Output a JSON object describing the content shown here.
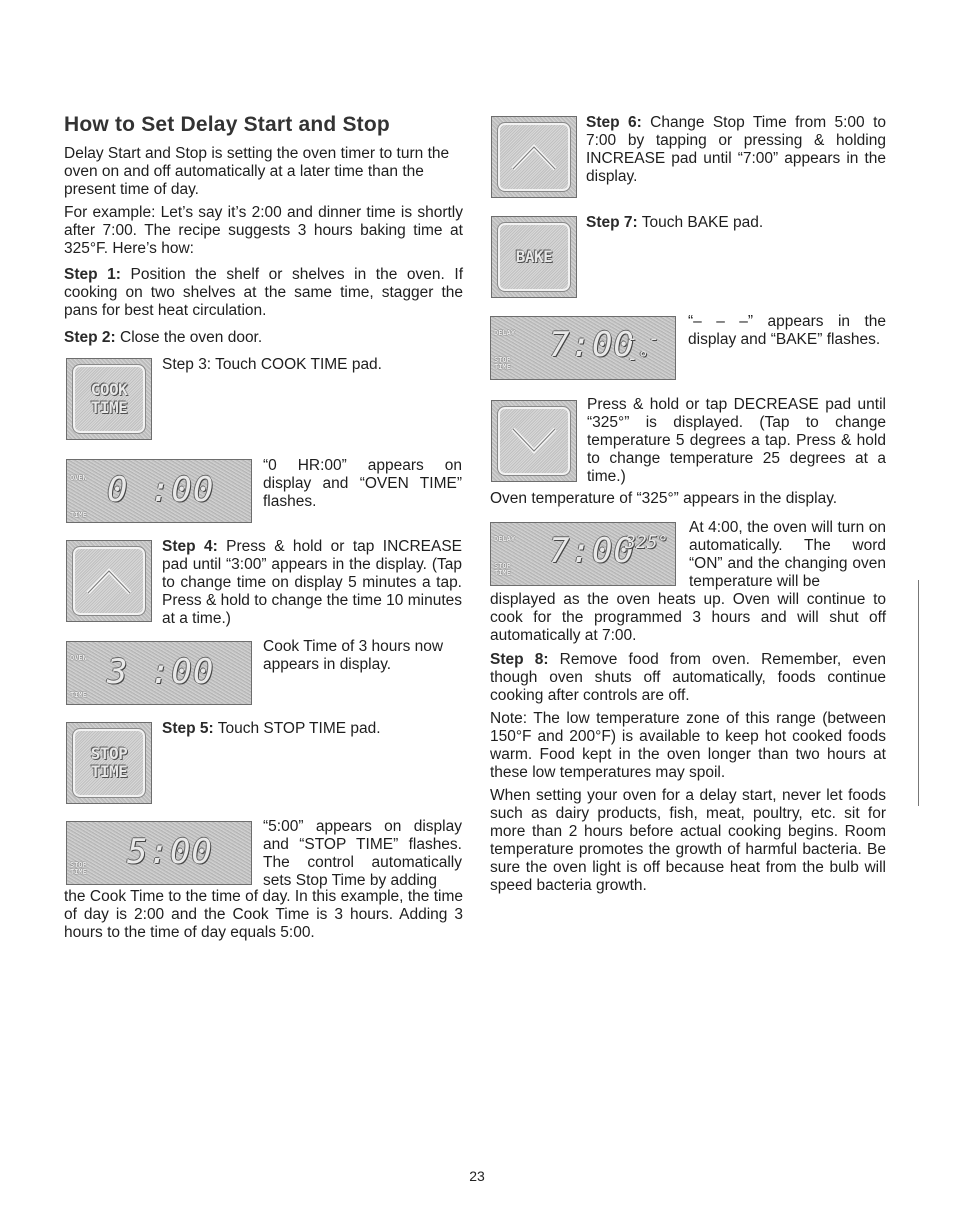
{
  "page": {
    "title": "How to Set Delay Start and Stop",
    "intro": "Delay Start and Stop is setting the oven timer to turn the oven on and off automatically at a later time than the present time of day.",
    "example": "For example: Let’s say it’s 2:00 and dinner time is shortly after 7:00. The recipe suggests 3 hours baking time at 325°F. Here’s how:",
    "page_number": "23"
  },
  "steps": {
    "s1": {
      "label": "Step 1:",
      "text": " Position the shelf or shelves in the oven. If cooking on two shelves at the same time, stagger the pans for best heat circulation."
    },
    "s2": {
      "label": "Step 2:",
      "text": " Close the oven door."
    },
    "s3": {
      "label": "Step 3:",
      "text": " Touch COOK TIME pad."
    },
    "s3_display": "“0 HR:00” appears on display and “OVEN TIME” flashes.",
    "s4": {
      "label": "Step 4:",
      "text": " Press & hold or tap INCREASE pad until “3:00” appears in the display. (Tap to change time on display 5 minutes a tap. Press & hold to change the time 10 minutes at a time.)"
    },
    "s4_display": "Cook Time of 3 hours now appears in display.",
    "s5": {
      "label": "Step 5:",
      "text": " Touch STOP TIME pad."
    },
    "s5_display_right": "“5:00” appears on display and “STOP TIME” flashes. The control automatically sets Stop Time by adding",
    "s5_display_full": "the Cook Time to the time of day. In this example, the time of day is 2:00 and the Cook Time is 3 hours. Adding 3 hours to the time of day equals 5:00.",
    "s6": {
      "label": "Step 6:",
      "text": " Change Stop Time from 5:00 to 7:00 by tapping or pressing & holding INCREASE pad until “7:00” appears in the display."
    },
    "s7": {
      "label": "Step 7:",
      "text": " Touch BAKE pad."
    },
    "s7_display": "“– – –” appears in the display and “BAKE” flashes.",
    "decrease_text": "Press & hold or tap DECREASE pad until “325°” is displayed. (Tap to change temperature 5 degrees a tap. Press & hold to change temperature 25 degrees at a time.)",
    "temp_text": "Oven temperature of “325°” appears in the display.",
    "auto_on_right": "At 4:00, the oven will turn on automatically. The word “ON” and the changing oven temperature will be",
    "auto_on_full": "displayed as the oven heats up. Oven will continue to cook for the programmed 3 hours and will shut off automatically at 7:00.",
    "s8": {
      "label": "Step 8:",
      "text": " Remove food from oven. Remember, even though oven shuts off automatically, foods continue cooking after controls are off."
    },
    "note": "Note: The low temperature zone of this range (between 150°F and 200°F) is available to keep hot cooked foods warm. Food kept in the oven longer than two hours at these low temperatures may spoil.",
    "warning": "When setting your oven for a delay start, never let foods such as dairy products, fish, meat, poultry, etc. sit for more than 2 hours before actual cooking begins. Room temperature promotes the growth of harmful bacteria. Be sure the oven light is off because heat from the bulb will speed bacteria growth."
  },
  "pads": {
    "cook_time": [
      "COOK",
      "TIME"
    ],
    "stop_time": [
      "STOP",
      "TIME"
    ],
    "bake": "BAKE",
    "increase_icon": "chevron-up-icon",
    "decrease_icon": "chevron-down-icon"
  },
  "displays": {
    "d1": {
      "top_tag": "OVEN",
      "bottom_tag": "TIME",
      "digits": "0 :00"
    },
    "d2": {
      "top_tag": "OVEN",
      "bottom_tag": "TIME",
      "digits": "3 :00"
    },
    "d3": {
      "bottom_tag": "STOP TIME",
      "digits": "5:00"
    },
    "d4": {
      "top_tag": "DELAY",
      "bottom_tag": "STOP TIME",
      "digits": "7:00",
      "extra": "- - -°"
    },
    "d5": {
      "top_tag": "DELAY",
      "bottom_tag": "STOP TIME",
      "digits": "7:00",
      "extra": "325°"
    }
  }
}
